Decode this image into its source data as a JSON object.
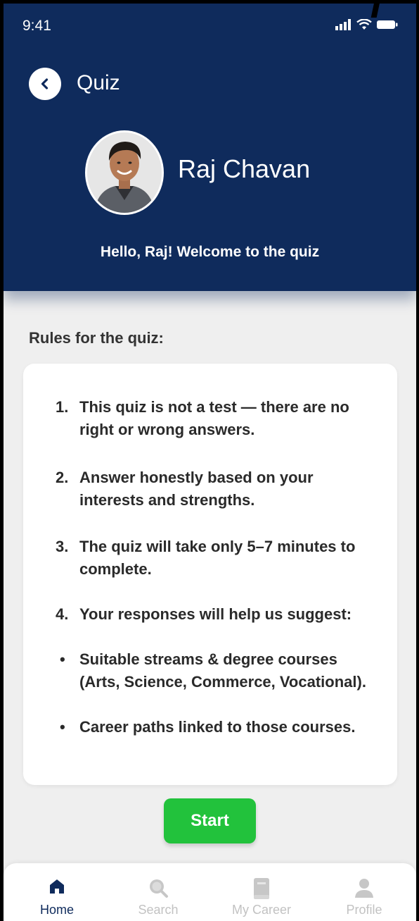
{
  "status_bar": {
    "time": "9:41"
  },
  "header": {
    "title": "Quiz",
    "user_name": "Raj Chavan",
    "welcome": "Hello, Raj! Welcome to the quiz"
  },
  "rules": {
    "heading": "Rules for the quiz:",
    "items": [
      {
        "num": "1.",
        "text": "This quiz is not a test — there are no right or wrong answers."
      },
      {
        "num": "2.",
        "text": "Answer honestly based on your interests and strengths."
      },
      {
        "num": "3.",
        "text": "The quiz will take only 5–7 minutes to complete."
      },
      {
        "num": "4.",
        "text": "Your responses will help us suggest:"
      }
    ],
    "bullets": [
      "Suitable streams & degree courses (Arts, Science, Commerce, Vocational).",
      "Career paths linked to those courses."
    ]
  },
  "actions": {
    "start_label": "Start"
  },
  "bottom_nav": {
    "items": [
      {
        "label": "Home",
        "icon": "home-icon",
        "active": true
      },
      {
        "label": "Search",
        "icon": "search-icon",
        "active": false
      },
      {
        "label": "My Career",
        "icon": "book-icon",
        "active": false
      },
      {
        "label": "Profile",
        "icon": "person-icon",
        "active": false
      }
    ]
  },
  "colors": {
    "header_bg": "#0f2b5c",
    "start_button": "#22c23c",
    "page_bg": "#efefef"
  }
}
